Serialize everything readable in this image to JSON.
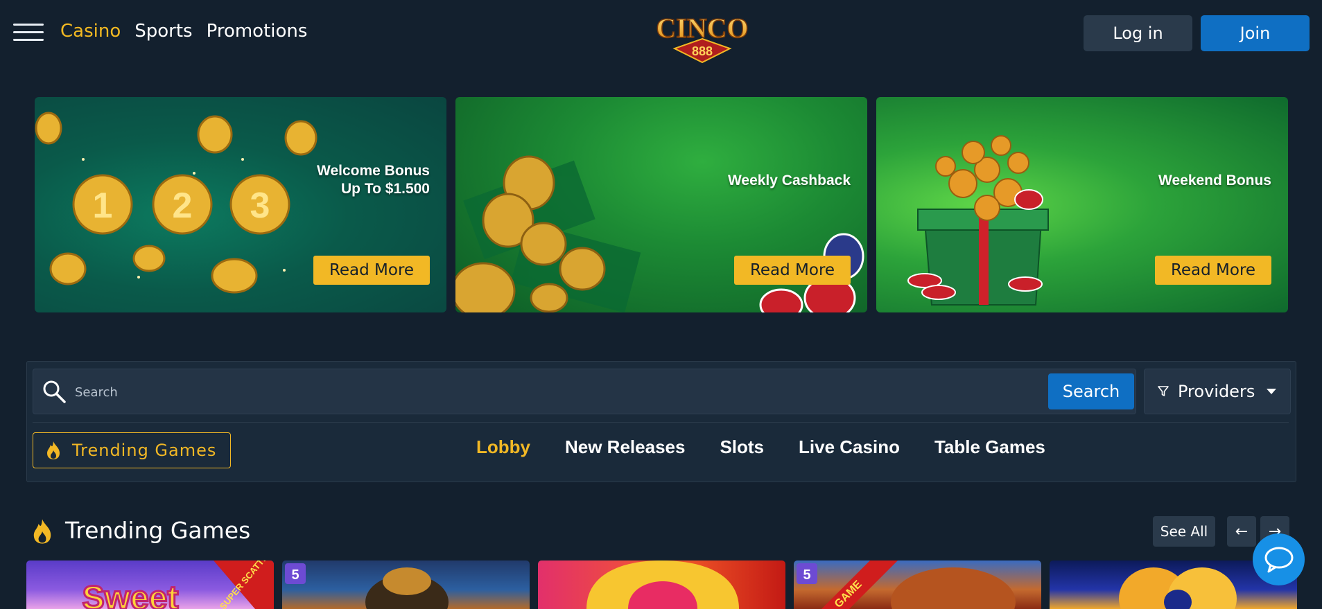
{
  "header": {
    "nav": [
      {
        "label": "Casino",
        "active": true
      },
      {
        "label": "Sports",
        "active": false
      },
      {
        "label": "Promotions",
        "active": false
      }
    ],
    "logo_text": "CINCO",
    "logo_subtext": "888",
    "login_label": "Log in",
    "join_label": "Join"
  },
  "banners": [
    {
      "title_line1": "Welcome Bonus",
      "title_line2": "Up To $1.500",
      "button": "Read More"
    },
    {
      "title_line1": "Weekly Cashback",
      "title_line2": "",
      "button": "Read More"
    },
    {
      "title_line1": "Weekend Bonus",
      "title_line2": "",
      "button": "Read More"
    }
  ],
  "search": {
    "placeholder": "Search",
    "value": "",
    "button_label": "Search",
    "providers_label": "Providers"
  },
  "categories": {
    "trending_label": "Trending Games",
    "items": [
      {
        "label": "Lobby",
        "active": true
      },
      {
        "label": "New Releases",
        "active": false
      },
      {
        "label": "Slots",
        "active": false
      },
      {
        "label": "Live Casino",
        "active": false
      },
      {
        "label": "Table Games",
        "active": false
      }
    ]
  },
  "trending_section": {
    "title": "Trending Games",
    "see_all_label": "See All",
    "prev_label": "←",
    "next_label": "→"
  },
  "games": [
    {
      "ribbon": "SUPER SCATTER"
    },
    {
      "ribbon": ""
    },
    {
      "ribbon": ""
    },
    {
      "ribbon": "GAME"
    },
    {
      "ribbon": ""
    }
  ],
  "colors": {
    "background": "#13202e",
    "accent_yellow": "#f2b825",
    "primary_blue": "#0f6fc3",
    "panel": "#1a2a3a"
  }
}
